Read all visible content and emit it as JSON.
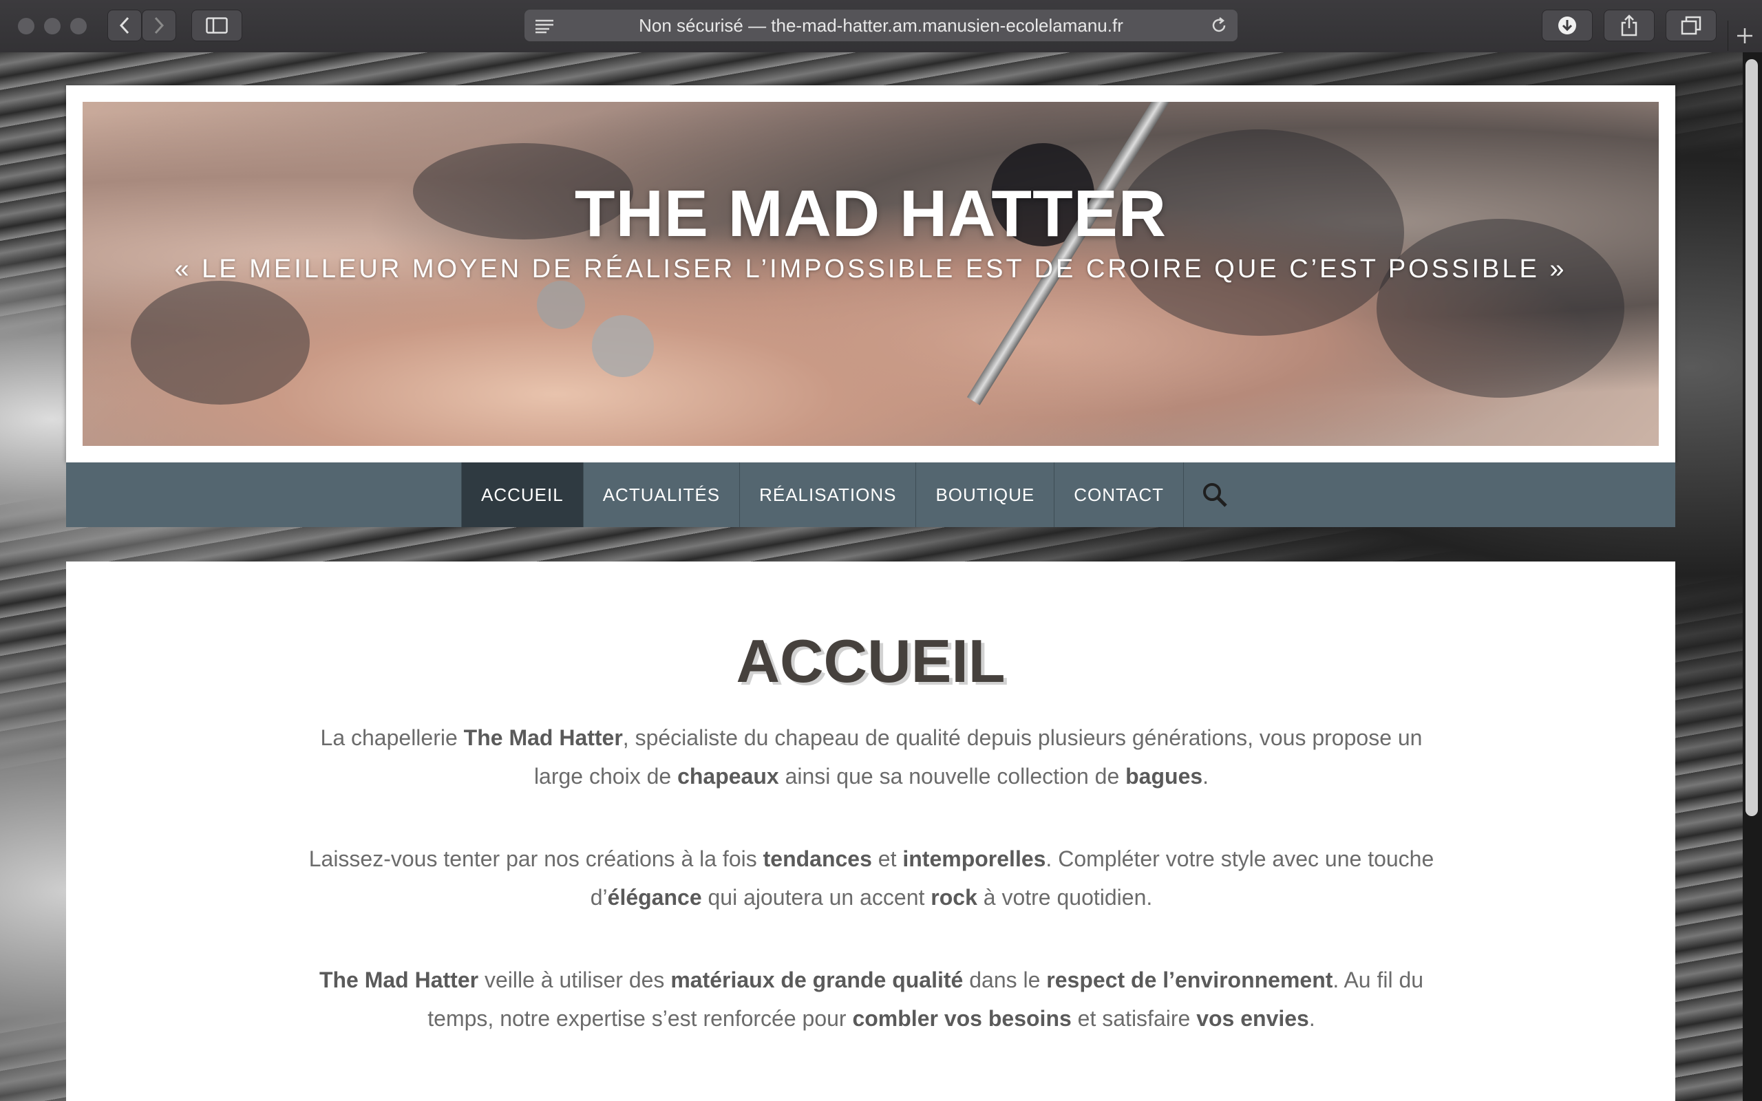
{
  "browser": {
    "url_text": "Non sécurisé — the-mad-hatter.am.manusien-ecolelamanu.fr"
  },
  "site": {
    "title": "THE MAD HATTER",
    "tagline": "« LE MEILLEUR MOYEN DE RÉALISER L’IMPOSSIBLE EST DE CROIRE QUE C’EST POSSIBLE »"
  },
  "nav": {
    "items": [
      "ACCUEIL",
      "ACTUALITÉS",
      "RÉALISATIONS",
      "BOUTIQUE",
      "CONTACT"
    ],
    "active": "ACCUEIL"
  },
  "content": {
    "title": "ACCUEIL",
    "p1": {
      "a": "La chapellerie ",
      "b": "The Mad Hatter",
      "c": ", spécialiste du chapeau de qualité depuis plusieurs générations, vous propose un large choix de ",
      "d": "chapeaux",
      "e": " ainsi que sa nouvelle collection de ",
      "f": "bagues",
      "g": "."
    },
    "p2": {
      "a": "Laissez-vous tenter par nos créations à la fois ",
      "b": "tendances",
      "c": " et ",
      "d": "intemporelles",
      "e": ". Compléter votre style avec une touche d’",
      "f": "élégance",
      "g": " qui ajoutera un accent ",
      "h": "rock",
      "i": " à votre quotidien."
    },
    "p3": {
      "a": "The Mad Hatter",
      "b": " veille à utiliser des ",
      "c": "matériaux de grande qualité",
      "d": " dans le ",
      "e": "respect de l’environnement",
      "f": ". Au fil du temps, notre expertise s’est renforcée pour ",
      "g": "combler vos besoins",
      "h": " et satisfaire ",
      "i": "vos envies",
      "j": "."
    }
  }
}
